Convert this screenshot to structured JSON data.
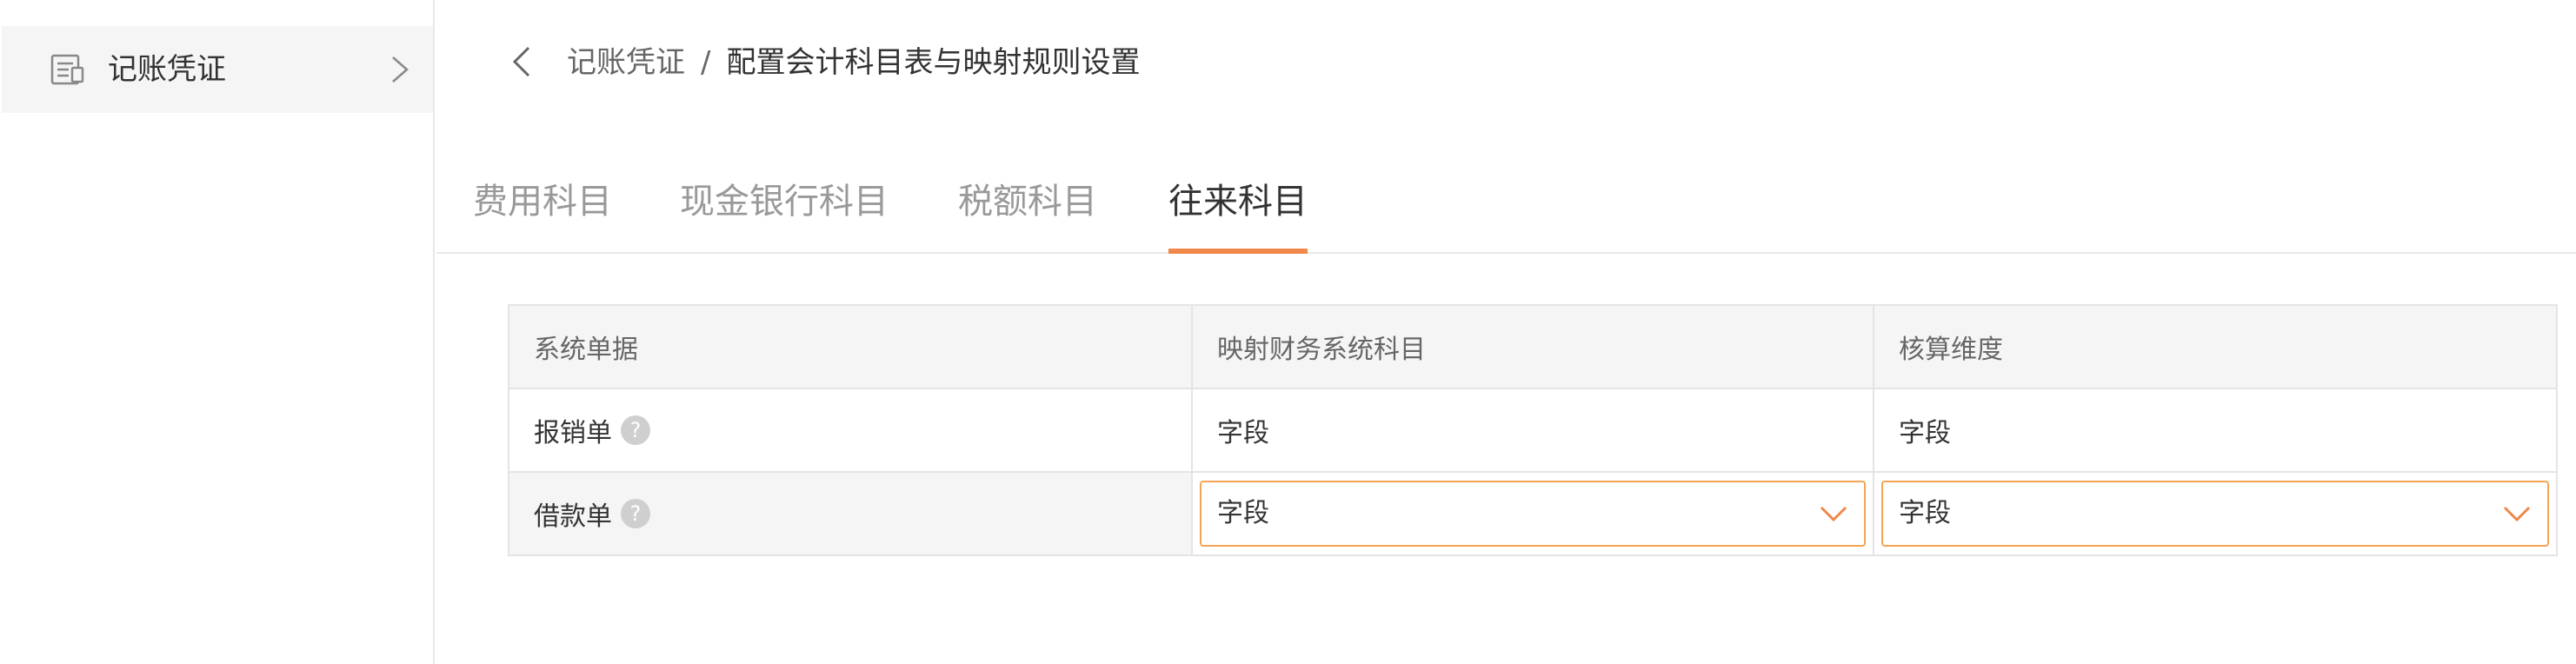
{
  "sidebar": {
    "item_label": "记账凭证",
    "item_icon": "voucher-icon",
    "chevron_icon": "chevron-right-icon"
  },
  "breadcrumb": {
    "back_icon": "chevron-left-icon",
    "parent": "记账凭证",
    "separator": "/",
    "current": "配置会计科目表与映射规则设置"
  },
  "tabs": [
    {
      "label": "费用科目",
      "active": false
    },
    {
      "label": "现金银行科目",
      "active": false
    },
    {
      "label": "税额科目",
      "active": false
    },
    {
      "label": "往来科目",
      "active": true
    }
  ],
  "table": {
    "headers": [
      "系统单据",
      "映射财务系统科目",
      "核算维度"
    ],
    "rows": [
      {
        "doc": "报销单",
        "help_icon": "?",
        "account": "字段",
        "dimension": "字段",
        "editable": false
      },
      {
        "doc": "借款单",
        "help_icon": "?",
        "account": "字段",
        "dimension": "字段",
        "editable": true
      }
    ]
  },
  "colors": {
    "accent": "#f0884a",
    "select_border": "#f5a554",
    "header_bg": "#f5f5f5",
    "border": "#e4e4e4"
  }
}
